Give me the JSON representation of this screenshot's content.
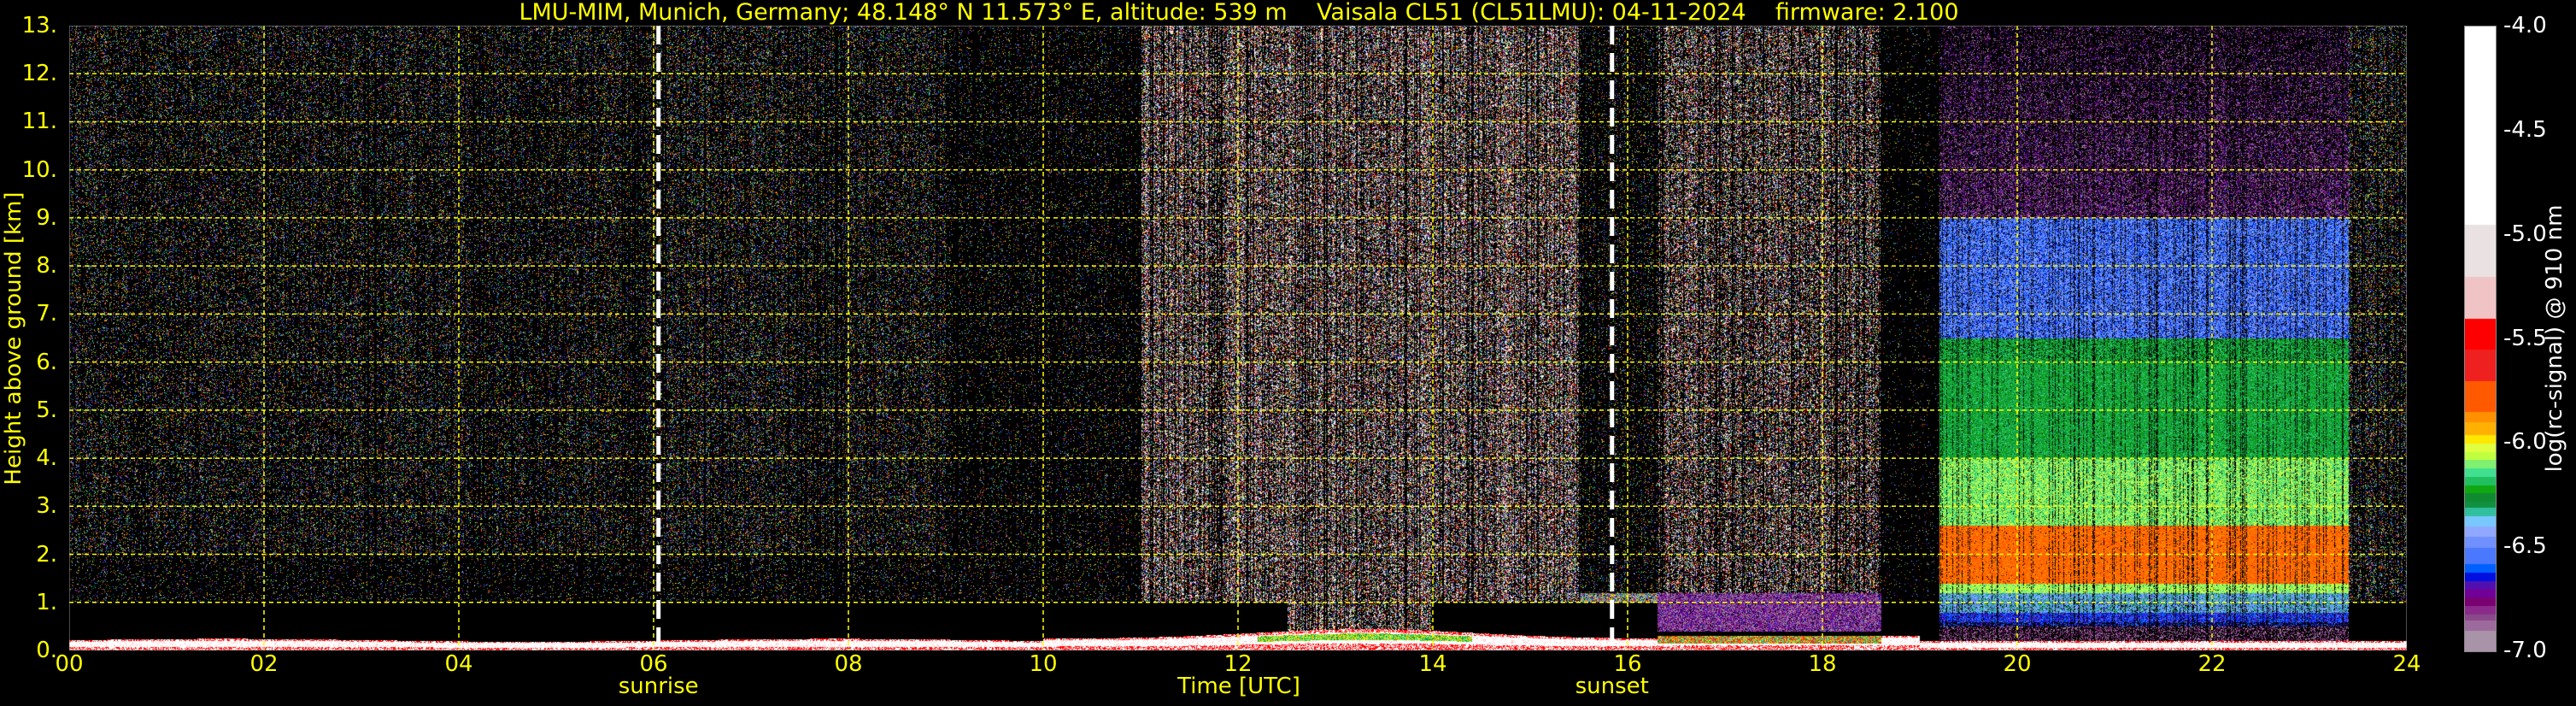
{
  "chart_data": {
    "type": "heatmap",
    "title": "LMU-MIM, Munich, Germany; 48.148° N 11.573° E, altitude: 539 m    Vaisala CL51 (CL51LMU): 04-11-2024    firmware: 2.100",
    "xlabel": "Time [UTC]",
    "ylabel": "Height above ground [km]",
    "xlim": [
      0,
      24
    ],
    "ylim": [
      0,
      13
    ],
    "x_ticks": [
      0,
      2,
      4,
      6,
      8,
      10,
      12,
      14,
      16,
      18,
      20,
      22,
      24
    ],
    "x_tick_labels": [
      "00",
      "02",
      "04",
      "06",
      "08",
      "10",
      "12",
      "14",
      "16",
      "18",
      "20",
      "22",
      "24"
    ],
    "y_ticks": [
      0,
      1,
      2,
      3,
      4,
      5,
      6,
      7,
      8,
      9,
      10,
      11,
      12,
      13
    ],
    "y_tick_labels": [
      "0.",
      "1.",
      "2.",
      "3.",
      "4.",
      "5.",
      "6.",
      "7.",
      "8.",
      "9.",
      "10.",
      "11.",
      "12.",
      "13."
    ],
    "grid": true,
    "grid_color": "#ffff00",
    "events": [
      {
        "label": "sunrise",
        "time": 6.05
      },
      {
        "label": "sunset",
        "time": 15.84
      }
    ],
    "colorbar": {
      "label": "log(rc-signal) @ 910 nm",
      "range": [
        -7.0,
        -4.0
      ],
      "ticks": [
        -4.0,
        -4.5,
        -5.0,
        -5.5,
        -6.0,
        -6.5,
        -7.0
      ],
      "tick_labels": [
        "-4.0",
        "-4.5",
        "-5.0",
        "-5.5",
        "-6.0",
        "-6.5",
        "-7.0"
      ],
      "levels": [
        {
          "from": -7.0,
          "to": -6.9,
          "color": "#a893a8"
        },
        {
          "from": -6.9,
          "to": -6.85,
          "color": "#9c6a9c"
        },
        {
          "from": -6.85,
          "to": -6.82,
          "color": "#8a4a8a"
        },
        {
          "from": -6.82,
          "to": -6.78,
          "color": "#8a2a8a"
        },
        {
          "from": -6.78,
          "to": -6.74,
          "color": "#780070"
        },
        {
          "from": -6.74,
          "to": -6.7,
          "color": "#700098"
        },
        {
          "from": -6.7,
          "to": -6.66,
          "color": "#5010b0"
        },
        {
          "from": -6.66,
          "to": -6.62,
          "color": "#0010e0"
        },
        {
          "from": -6.62,
          "to": -6.58,
          "color": "#0060ff"
        },
        {
          "from": -6.58,
          "to": -6.5,
          "color": "#4a78ff"
        },
        {
          "from": -6.5,
          "to": -6.45,
          "color": "#7090ff"
        },
        {
          "from": -6.45,
          "to": -6.4,
          "color": "#90a8ff"
        },
        {
          "from": -6.4,
          "to": -6.35,
          "color": "#78c8ff"
        },
        {
          "from": -6.35,
          "to": -6.31,
          "color": "#30c0a0"
        },
        {
          "from": -6.31,
          "to": -6.28,
          "color": "#109040"
        },
        {
          "from": -6.28,
          "to": -6.24,
          "color": "#108a30"
        },
        {
          "from": -6.24,
          "to": -6.2,
          "color": "#10a810"
        },
        {
          "from": -6.2,
          "to": -6.16,
          "color": "#20c060"
        },
        {
          "from": -6.16,
          "to": -6.12,
          "color": "#40e090"
        },
        {
          "from": -6.12,
          "to": -6.08,
          "color": "#80f070"
        },
        {
          "from": -6.08,
          "to": -6.04,
          "color": "#c0ff40"
        },
        {
          "from": -6.04,
          "to": -6.0,
          "color": "#e0ff40"
        },
        {
          "from": -6.0,
          "to": -5.96,
          "color": "#ffe800"
        },
        {
          "from": -5.96,
          "to": -5.9,
          "color": "#ffb000"
        },
        {
          "from": -5.9,
          "to": -5.85,
          "color": "#ff9000"
        },
        {
          "from": -5.85,
          "to": -5.7,
          "color": "#ff5a00"
        },
        {
          "from": -5.7,
          "to": -5.55,
          "color": "#ee2020"
        },
        {
          "from": -5.55,
          "to": -5.4,
          "color": "#ff0000"
        },
        {
          "from": -5.4,
          "to": -5.2,
          "color": "#f0c4c4"
        },
        {
          "from": -5.2,
          "to": -4.95,
          "color": "#eae2e2"
        },
        {
          "from": -4.95,
          "to": -4.0,
          "color": "#ffffff"
        }
      ]
    }
  }
}
